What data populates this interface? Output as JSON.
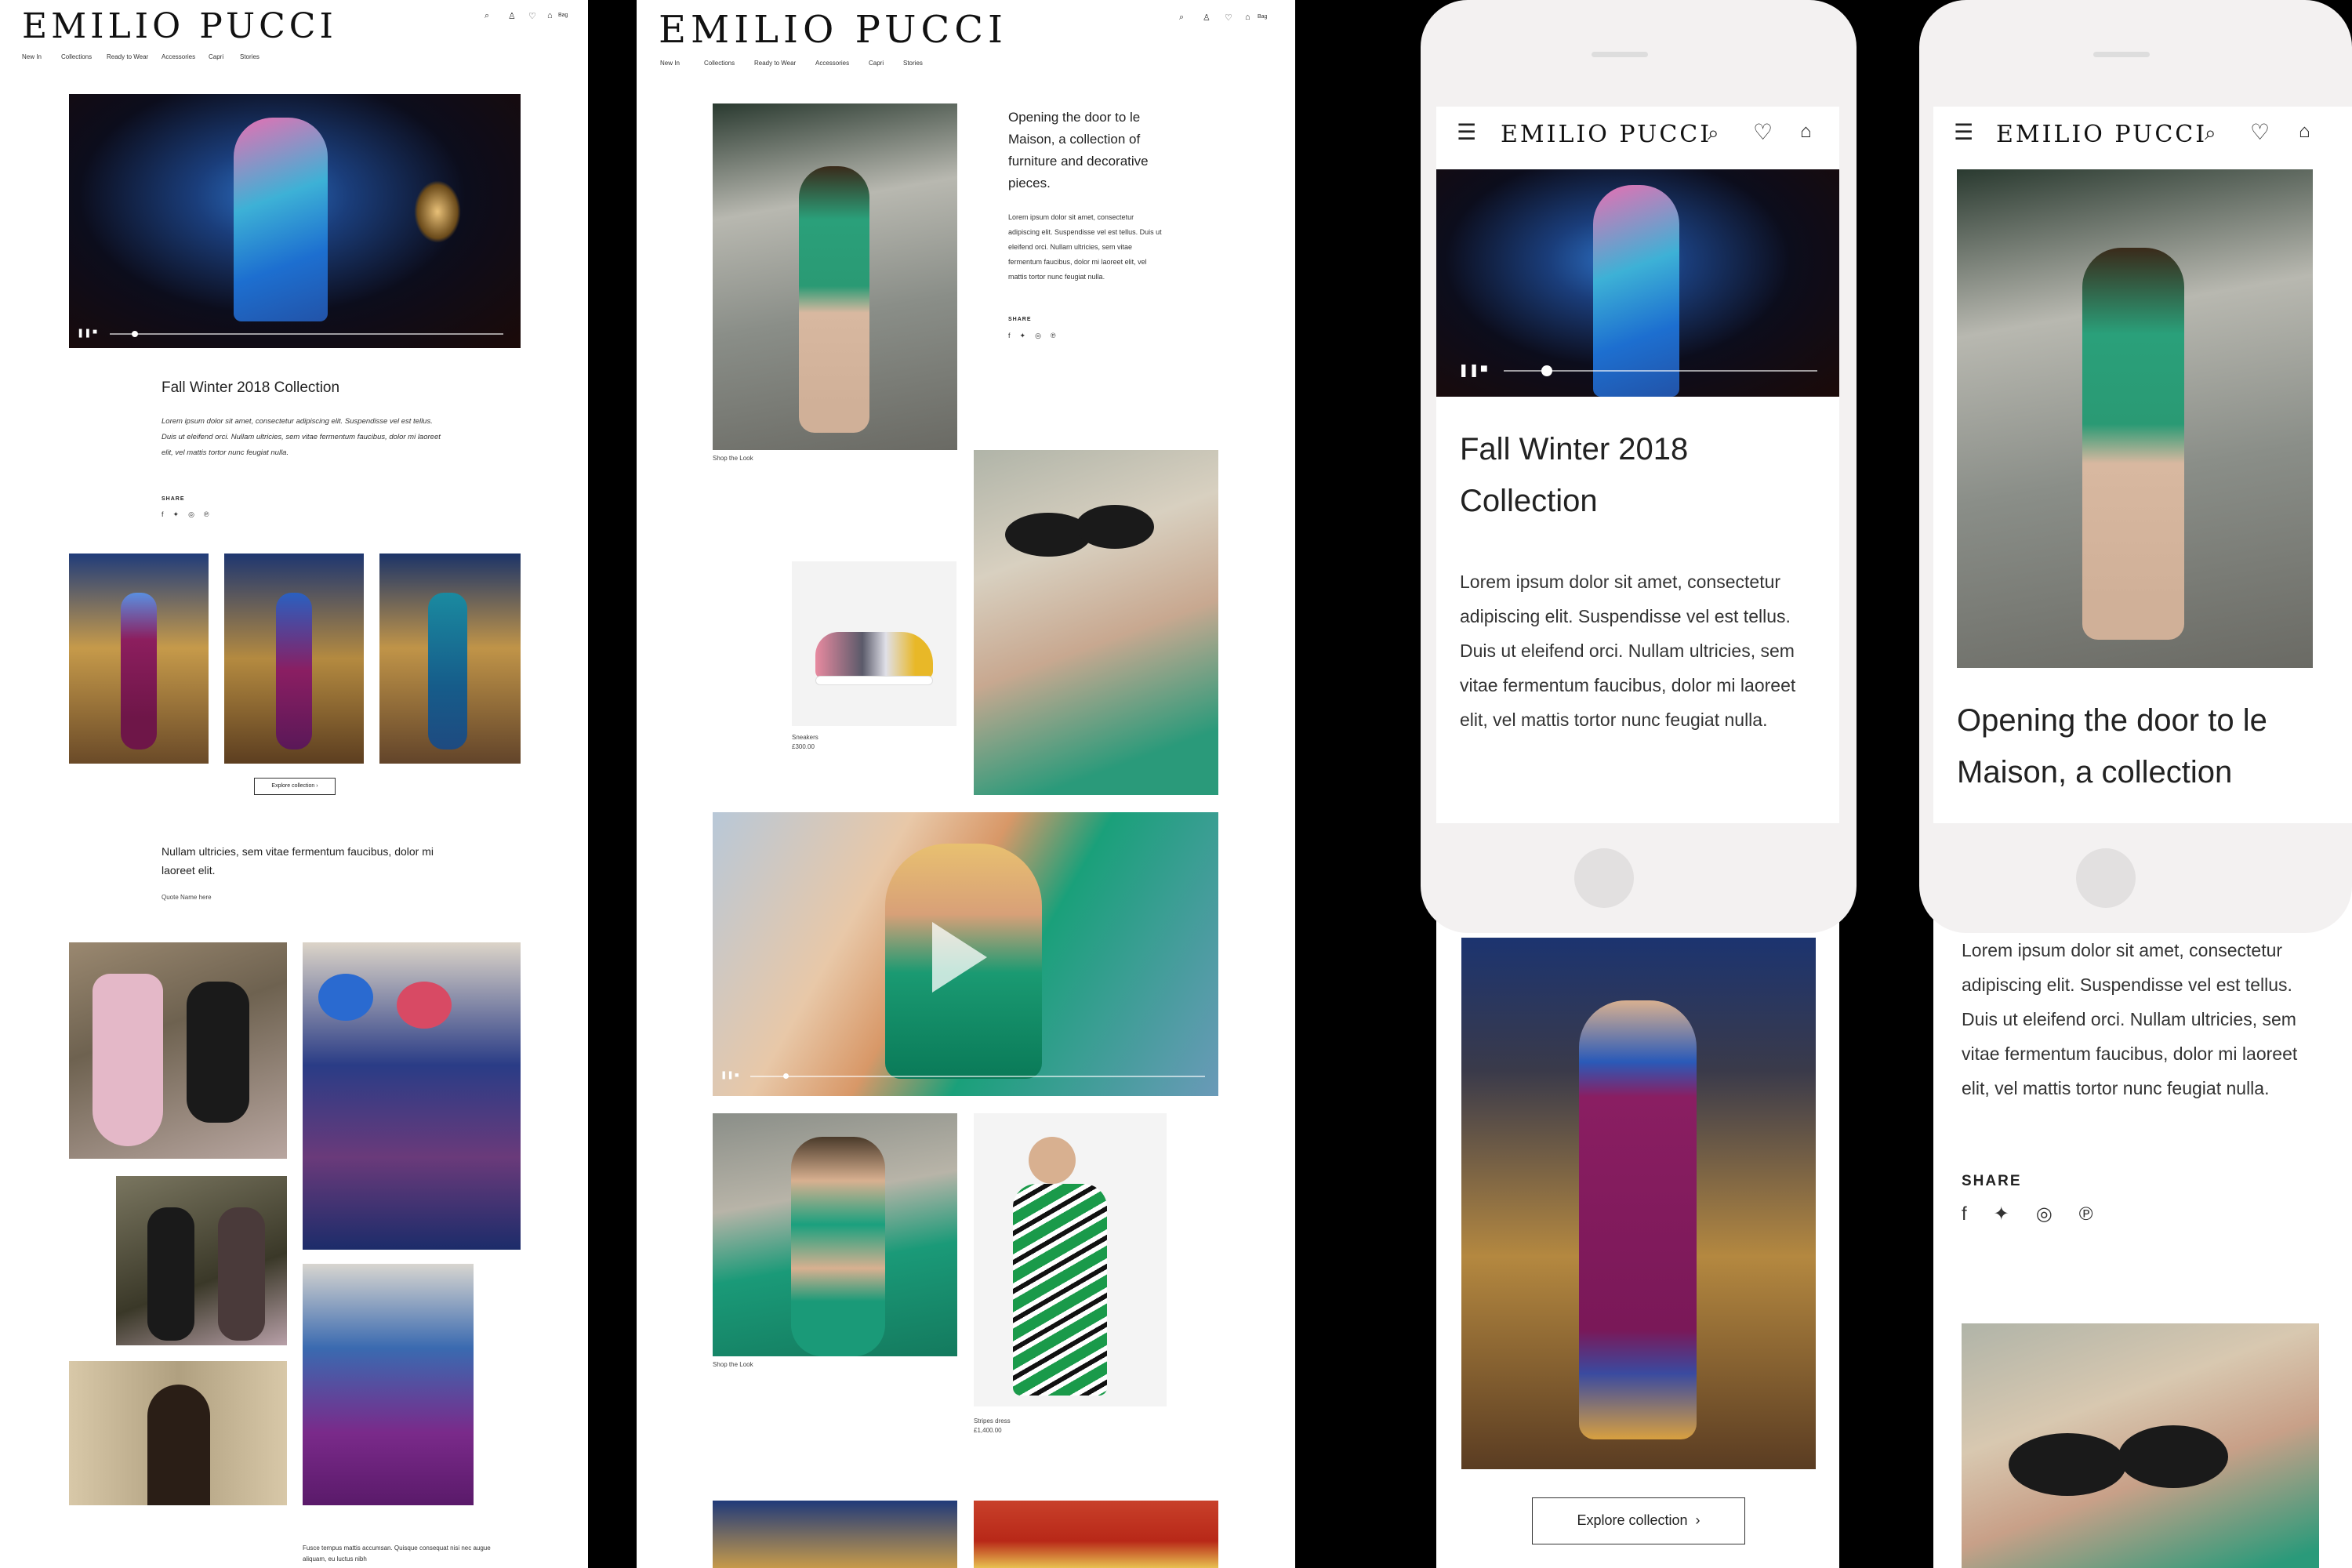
{
  "brand": {
    "logo": "EMILIO PUCCI",
    "accent": "#111111"
  },
  "nav": [
    "New In",
    "Collections",
    "Ready to Wear",
    "Accessories",
    "Capri",
    "Stories"
  ],
  "header_icons": [
    "search-icon",
    "user-icon",
    "heart-icon",
    "bag-icon"
  ],
  "bag_label": "Bag",
  "desktop_left": {
    "collection_title": "Fall Winter 2018 Collection",
    "collection_body": "Lorem ipsum dolor sit amet, consectetur adipiscing elit. Suspendisse vel est tellus. Duis ut eleifend orci. Nullam ultricies, sem vitae fermentum faucibus, dolor mi laoreet elit, vel mattis tortor nunc feugiat nulla.",
    "share_label": "SHARE",
    "explore_label": "Explore collection",
    "quote": "Nullam ultricies, sem vitae fermentum faucibus, dolor mi laoreet elit.",
    "quote_name": "Quote Name here",
    "footer_text": "Fusce tempus mattis accumsan. Quisque consequat nisi nec augue aliquam, eu luctus nibh"
  },
  "desktop_right": {
    "intro_title": "Opening the door to le Maison, a collection of furniture and decorative pieces.",
    "intro_body": "Lorem ipsum dolor sit amet, consectetur adipiscing elit. Suspendisse vel est tellus. Duis ut eleifend orci. Nullam ultricies, sem vitae fermentum faucibus, dolor mi laoreet elit, vel mattis tortor nunc feugiat nulla.",
    "share_label": "SHARE",
    "shop_look_1": "Shop the Look",
    "sneakers_name": "Sneakers",
    "sneakers_price": "£300.00",
    "shop_look_2": "Shop the Look",
    "dress_name": "Stripes dress",
    "dress_price": "£1,400.00"
  },
  "mobile_1": {
    "title": "Fall Winter 2018 Collection",
    "body": "Lorem ipsum dolor sit amet, consectetur adipiscing elit. Suspendisse vel est tellus. Duis ut eleifend orci. Nullam ultricies, sem vitae fermentum faucibus, dolor mi laoreet elit, vel mattis tortor nunc feugiat nulla.",
    "explore_label": "Explore collection"
  },
  "mobile_2": {
    "title": "Opening the door to le Maison, a collection",
    "body": "Lorem ipsum dolor sit amet, consectetur adipiscing elit. Suspendisse vel est tellus. Duis ut eleifend orci. Nullam ultricies, sem vitae fermentum faucibus, dolor mi laoreet elit, vel mattis tortor nunc feugiat nulla.",
    "share_label": "SHARE"
  },
  "share_icons": [
    "facebook-icon",
    "twitter-icon",
    "instagram-icon",
    "pinterest-icon"
  ]
}
